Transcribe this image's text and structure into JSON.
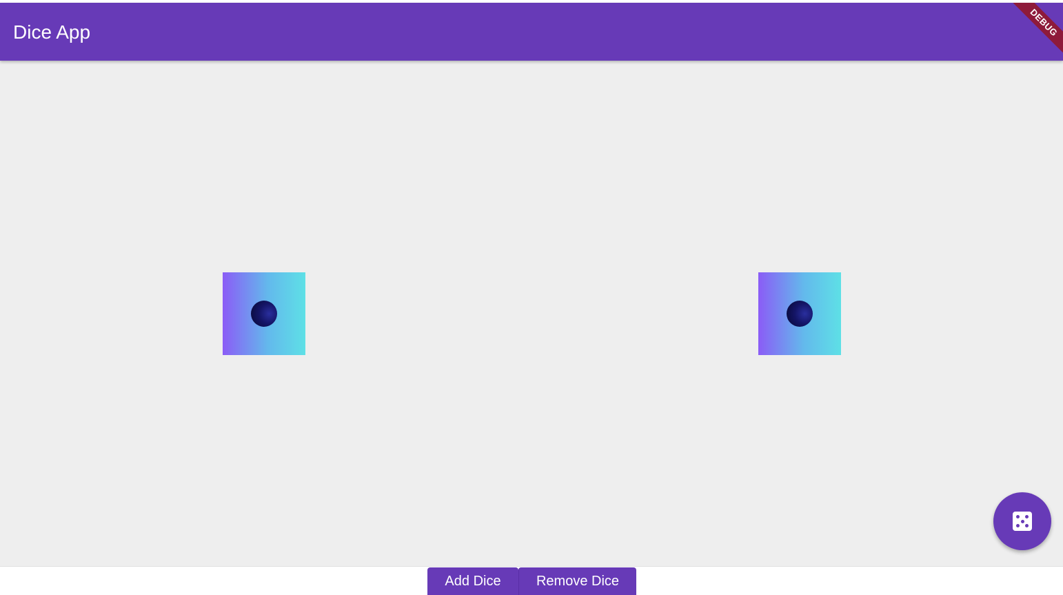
{
  "app": {
    "title": "Dice App",
    "debug_banner": "DEBUG",
    "accent_color": "#673ab7"
  },
  "dice": [
    {
      "value": 1,
      "pips": 1
    },
    {
      "value": 1,
      "pips": 1
    }
  ],
  "fab": {
    "icon": "dice-icon"
  },
  "actions": {
    "add_label": "Add Dice",
    "remove_label": "Remove Dice"
  }
}
